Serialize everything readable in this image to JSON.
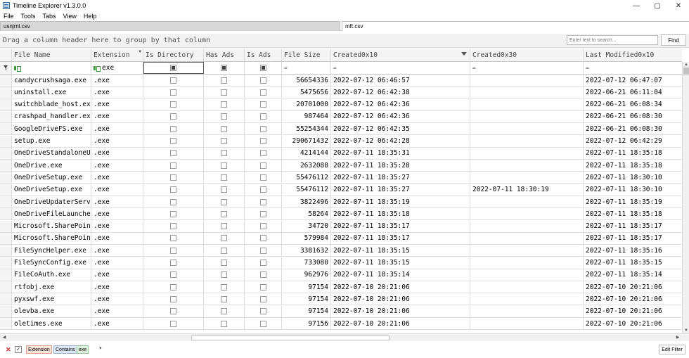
{
  "window": {
    "title": "Timeline Explorer v1.3.0.0",
    "minimize": "—",
    "maximize": "▢",
    "close": "✕"
  },
  "menu": [
    "File",
    "Tools",
    "Tabs",
    "View",
    "Help"
  ],
  "tabs": [
    "usnjrnl.csv",
    "mft.csv"
  ],
  "groupbar": {
    "hint": "Drag a column header here to group by that column",
    "search_placeholder": "Enter text to search...",
    "find_label": "Find"
  },
  "columns": [
    "File Name",
    "Extension",
    "Is Directory",
    "Has Ads",
    "Is Ads",
    "File Size",
    "Created0x10",
    "Created0x30",
    "Last Modified0x10"
  ],
  "filter_row": {
    "extension_value": "exe",
    "equals_glyph": "="
  },
  "rows": [
    {
      "name": "candycrushsaga.exe",
      "ext": ".exe",
      "size": "56654336",
      "c10": "2022-07-12 06:46:57",
      "c30": "",
      "m10": "2022-07-12 06:47:07"
    },
    {
      "name": "uninstall.exe",
      "ext": ".exe",
      "size": "5475656",
      "c10": "2022-07-12 06:42:38",
      "c30": "",
      "m10": "2022-06-21 06:11:04"
    },
    {
      "name": "switchblade_host.exe",
      "ext": ".exe",
      "size": "20701000",
      "c10": "2022-07-12 06:42:36",
      "c30": "",
      "m10": "2022-06-21 06:08:34"
    },
    {
      "name": "crashpad_handler.exe",
      "ext": ".exe",
      "size": "987464",
      "c10": "2022-07-12 06:42:36",
      "c30": "",
      "m10": "2022-06-21 06:08:30"
    },
    {
      "name": "GoogleDriveFS.exe",
      "ext": ".exe",
      "size": "55254344",
      "c10": "2022-07-12 06:42:35",
      "c30": "",
      "m10": "2022-06-21 06:08:30"
    },
    {
      "name": "setup.exe",
      "ext": ".exe",
      "size": "290671432",
      "c10": "2022-07-12 06:42:28",
      "c30": "",
      "m10": "2022-07-12 06:42:29"
    },
    {
      "name": "OneDriveStandaloneUpdater.exe",
      "ext": ".exe",
      "size": "4214144",
      "c10": "2022-07-11 18:35:31",
      "c30": "",
      "m10": "2022-07-11 18:35:18"
    },
    {
      "name": "OneDrive.exe",
      "ext": ".exe",
      "size": "2632088",
      "c10": "2022-07-11 18:35:28",
      "c30": "",
      "m10": "2022-07-11 18:35:18"
    },
    {
      "name": "OneDriveSetup.exe",
      "ext": ".exe",
      "size": "55476112",
      "c10": "2022-07-11 18:35:27",
      "c30": "",
      "m10": "2022-07-11 18:30:10"
    },
    {
      "name": "OneDriveSetup.exe",
      "ext": ".exe",
      "size": "55476112",
      "c10": "2022-07-11 18:35:27",
      "c30": "2022-07-11 18:30:19",
      "m10": "2022-07-11 18:30:10"
    },
    {
      "name": "OneDriveUpdaterService.exe",
      "ext": ".exe",
      "size": "3822496",
      "c10": "2022-07-11 18:35:19",
      "c30": "",
      "m10": "2022-07-11 18:35:19"
    },
    {
      "name": "OneDriveFileLauncher.exe",
      "ext": ".exe",
      "size": "58264",
      "c10": "2022-07-11 18:35:18",
      "c30": "",
      "m10": "2022-07-11 18:35:18"
    },
    {
      "name": "Microsoft.SharePoint.exe",
      "ext": ".exe",
      "size": "34720",
      "c10": "2022-07-11 18:35:17",
      "c30": "",
      "m10": "2022-07-11 18:35:17"
    },
    {
      "name": "Microsoft.SharePoint.exe",
      "ext": ".exe",
      "size": "579984",
      "c10": "2022-07-11 18:35:17",
      "c30": "",
      "m10": "2022-07-11 18:35:17"
    },
    {
      "name": "FileSyncHelper.exe",
      "ext": ".exe",
      "size": "3381632",
      "c10": "2022-07-11 18:35:15",
      "c30": "",
      "m10": "2022-07-11 18:35:16"
    },
    {
      "name": "FileSyncConfig.exe",
      "ext": ".exe",
      "size": "733080",
      "c10": "2022-07-11 18:35:15",
      "c30": "",
      "m10": "2022-07-11 18:35:15"
    },
    {
      "name": "FileCoAuth.exe",
      "ext": ".exe",
      "size": "962976",
      "c10": "2022-07-11 18:35:14",
      "c30": "",
      "m10": "2022-07-11 18:35:14"
    },
    {
      "name": "rtfobj.exe",
      "ext": ".exe",
      "size": "97154",
      "c10": "2022-07-10 20:21:06",
      "c30": "",
      "m10": "2022-07-10 20:21:06"
    },
    {
      "name": "pyxswf.exe",
      "ext": ".exe",
      "size": "97154",
      "c10": "2022-07-10 20:21:06",
      "c30": "",
      "m10": "2022-07-10 20:21:06"
    },
    {
      "name": "olevba.exe",
      "ext": ".exe",
      "size": "97154",
      "c10": "2022-07-10 20:21:06",
      "c30": "",
      "m10": "2022-07-10 20:21:06"
    },
    {
      "name": "oletimes.exe",
      "ext": ".exe",
      "size": "97156",
      "c10": "2022-07-10 20:21:06",
      "c30": "",
      "m10": "2022-07-10 20:21:06"
    }
  ],
  "filterbar": {
    "clear": "✕",
    "enabled": "✓",
    "field": "Extension",
    "operator": "Contains",
    "value": "exe",
    "dropdown": "▾",
    "edit_label": "Edit Filter"
  },
  "scroll": {
    "up": "▲",
    "down": "▼",
    "left": "◀",
    "right": "▶"
  }
}
